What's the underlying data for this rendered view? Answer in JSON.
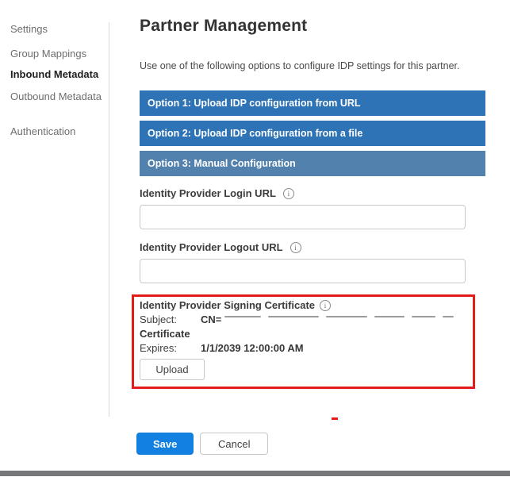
{
  "sidebar": {
    "items": [
      {
        "label": "Settings",
        "active": false
      },
      {
        "label": "Group Mappings",
        "active": false
      },
      {
        "label": "Inbound Metadata",
        "active": true
      },
      {
        "label": "Outbound Metadata",
        "active": false
      },
      {
        "label": "Authentication",
        "active": false
      }
    ]
  },
  "main": {
    "title": "Partner Management",
    "intro": "Use one of the following options to configure IDP settings for this partner.",
    "options": [
      {
        "label": "Option 1: Upload IDP configuration from URL"
      },
      {
        "label": "Option 2: Upload IDP configuration from a file"
      },
      {
        "label": "Option 3: Manual Configuration"
      }
    ],
    "fields": {
      "login_url": {
        "label": "Identity Provider Login URL",
        "value": "",
        "placeholder": ""
      },
      "logout_url": {
        "label": "Identity Provider Logout URL",
        "value": "",
        "placeholder": ""
      }
    },
    "certificate": {
      "label": "Identity Provider Signing Certificate",
      "subject_label": "Subject:",
      "subject_value_visible": "CN=",
      "subject_value_wrap": "Certificate",
      "expires_label": "Expires:",
      "expires_value": "1/1/2039 12:00:00 AM",
      "upload_label": "Upload"
    },
    "actions": {
      "save_label": "Save",
      "cancel_label": "Cancel"
    }
  },
  "icons": {
    "info": "info-icon"
  },
  "colors": {
    "option_bar_blue": "#2e73b6",
    "option_bar_muted": "#5381ad",
    "save_blue": "#1180e0",
    "annotation_red": "#e21b1b",
    "bottom_bar_gray": "#76787a",
    "divider_gray": "#d9d9d9"
  }
}
